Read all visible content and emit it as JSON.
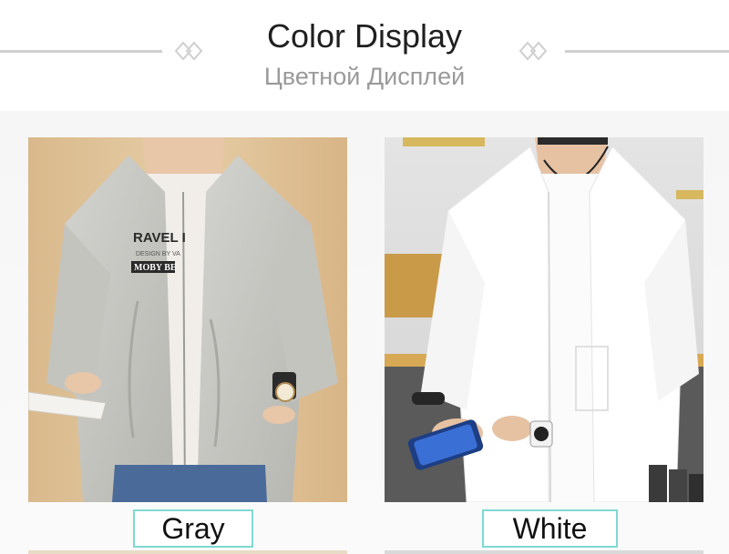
{
  "header": {
    "title": "Color Display",
    "subtitle": "Цветной Дисплей"
  },
  "colors": [
    {
      "label": "Gray",
      "swatch": "#c9c9c5",
      "icon": "gray-jacket-photo"
    },
    {
      "label": "White",
      "swatch": "#ffffff",
      "icon": "white-jacket-photo"
    }
  ],
  "photo_prints": {
    "tshirt_line1": "RAVEL I",
    "tshirt_line2": "DESIGN BY VA",
    "tshirt_line3": "MOBY BE"
  },
  "theme": {
    "rule_color": "#cfcfcf",
    "label_border": "#7fd9d2",
    "subtitle_color": "#9a9a9a"
  }
}
